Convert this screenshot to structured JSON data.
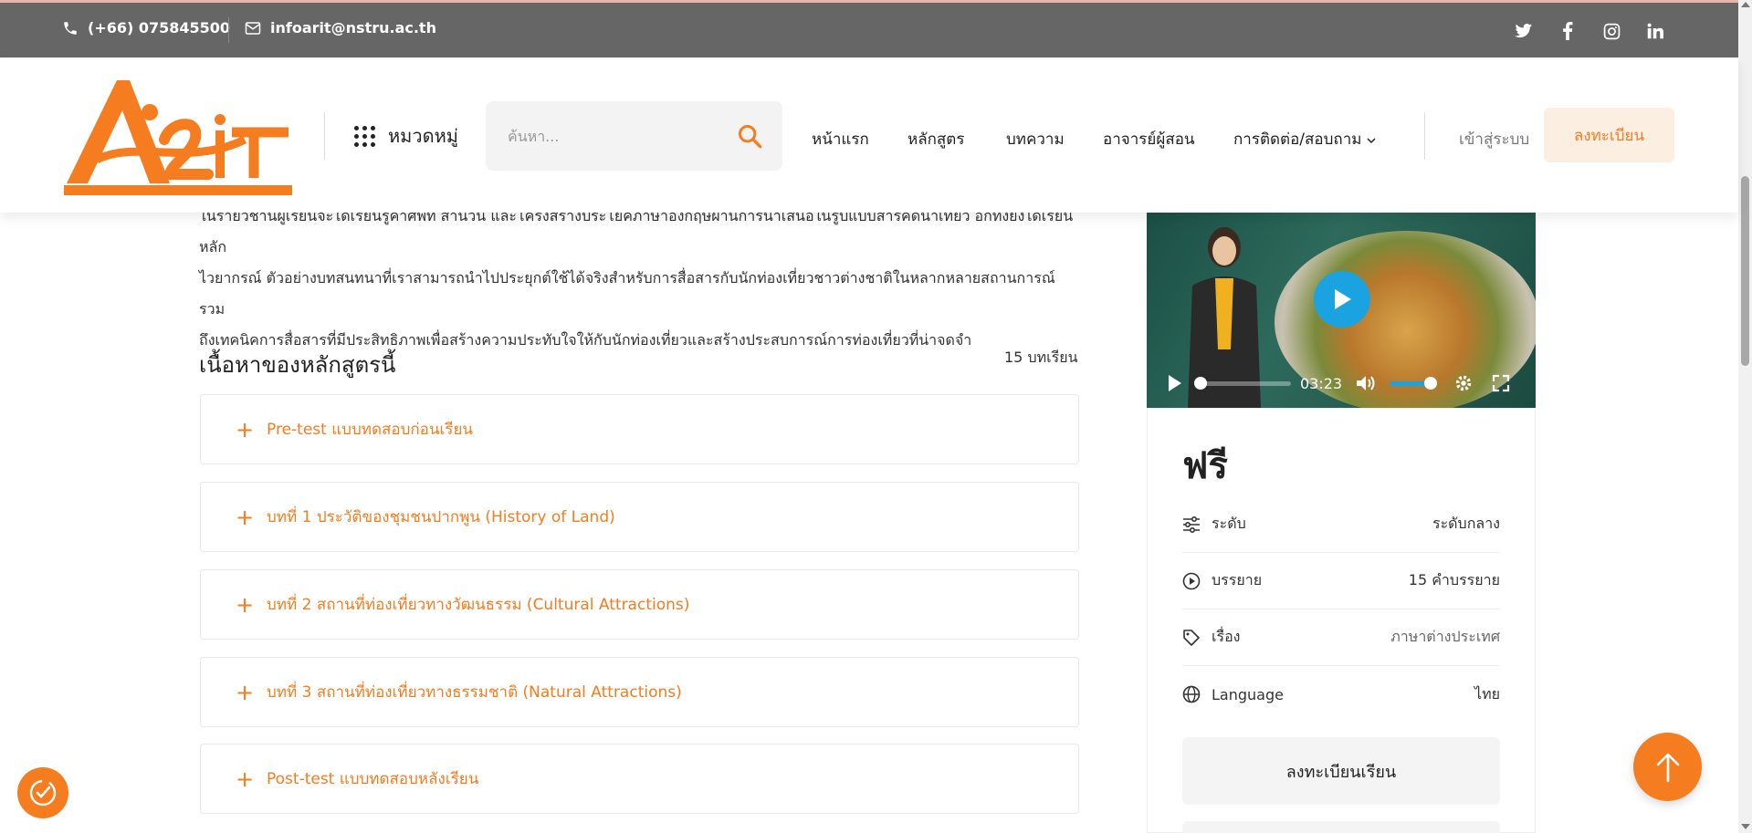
{
  "topbar": {
    "phone": "(+66) 075845500",
    "email": "infoarit@nstru.ac.th",
    "social": [
      "twitter-icon",
      "facebook-icon",
      "instagram-icon",
      "linkedin-icon"
    ]
  },
  "header": {
    "category_label": "หมวดหมู่",
    "search_placeholder": "ค้นหา...",
    "nav": [
      "หน้าแรก",
      "หลักสูตร",
      "บทความ",
      "อาจารย์ผู้สอน",
      "การติดต่อ/สอบถาม"
    ],
    "login": "เข้าสู่ระบบ",
    "register": "ลงทะเบียน"
  },
  "main": {
    "description_lines": [
      "ในรายวิชานี้ผู้เรียนจะได้เรียนรู้คำศัพท์ สำนวน และโครงสร้างประโยคภาษาอังกฤษผ่านการนำเสนอในรูปแบบสารคดีนำเที่ยว อีกทั้งยังได้เรียนหลัก",
      "ไวยากรณ์ ตัวอย่างบทสนทนาที่เราสามารถนำไปประยุกต์ใช้ได้จริงสำหรับการสื่อสารกับนักท่องเที่ยวชาวต่างชาติในหลากหลายสถานการณ์ รวม",
      "ถึงเทคนิคการสื่อสารที่มีประสิทธิภาพเพื่อสร้างความประทับใจให้กับนักท่องเที่ยวและสร้างประสบการณ์การท่องเที่ยวที่น่าจดจำ"
    ],
    "content_title": "เนื้อหาของหลักสูตรนี้",
    "lesson_count": "15 บทเรียน",
    "lessons": [
      "Pre-test แบบทดสอบก่อนเรียน",
      "บทที่ 1 ประวัติของชุมชนปากพูน (History of Land)",
      "บทที่ 2 สถานที่ท่องเที่ยวทางวัฒนธรรม (Cultural Attractions)",
      "บทที่ 3 สถานที่ท่องเที่ยวทางธรรมชาติ (Natural Attractions)",
      "Post-test แบบทดสอบหลังเรียน"
    ]
  },
  "video": {
    "time": "03:23",
    "progress": 0.0,
    "volume": 0.75
  },
  "card": {
    "price": "ฟรี",
    "rows": [
      {
        "icon": "sliders-icon",
        "key": "ระดับ",
        "value": "ระดับกลาง"
      },
      {
        "icon": "play-circle-icon",
        "key": "บรรยาย",
        "value": "15 คำบรรยาย"
      },
      {
        "icon": "tag-icon",
        "key": "เรื่อง",
        "value": "ภาษาต่างประเทศ"
      },
      {
        "icon": "globe-icon",
        "key": "Language",
        "value": "ไทย"
      }
    ],
    "enroll": "ลงทะเบียนเรียน"
  },
  "colors": {
    "accent": "#f57c1f",
    "topbar": "#666666",
    "player_blue": "#1aa3e0"
  }
}
